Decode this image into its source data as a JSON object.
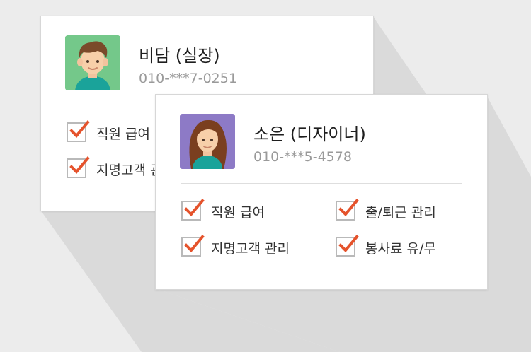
{
  "colors": {
    "background": "#ececec",
    "shadow": "#dadada",
    "card_background": "#ffffff",
    "check_mark": "#e5532c",
    "avatar_male_bg": "#74c88a",
    "avatar_female_bg": "#8d7ac6"
  },
  "cards": [
    {
      "avatar_icon": "male-avatar-icon",
      "name": "비담 (실장)",
      "phone": "010-***7-0251",
      "permissions": [
        {
          "label": "직원 급여",
          "checked": true
        },
        {
          "label": "지명고객 관리",
          "checked": true
        }
      ]
    },
    {
      "avatar_icon": "female-avatar-icon",
      "name": "소은 (디자이너)",
      "phone": "010-***5-4578",
      "permissions": [
        {
          "label": "직원 급여",
          "checked": true
        },
        {
          "label": "출/퇴근 관리",
          "checked": true
        },
        {
          "label": "지명고객 관리",
          "checked": true
        },
        {
          "label": "봉사료 유/무",
          "checked": true
        }
      ]
    }
  ]
}
